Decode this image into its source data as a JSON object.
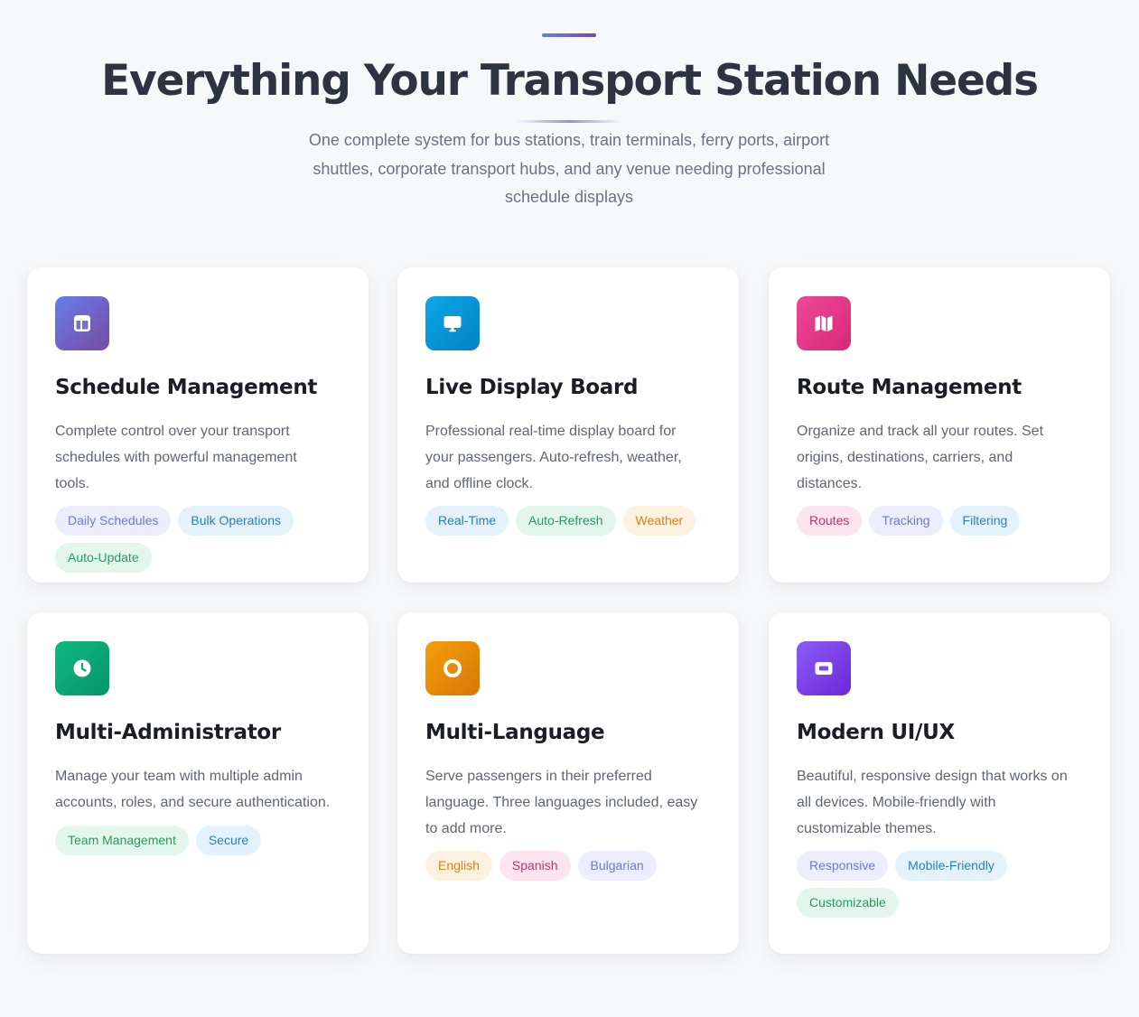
{
  "header": {
    "title": "Everything Your Transport Station Needs",
    "subtitle": "One complete system for bus stations, train terminals, ferry ports, airport shuttles, corporate transport hubs, and any venue needing professional schedule displays"
  },
  "colors": {
    "accent_start": "#667eea",
    "accent_end": "#764ba2"
  },
  "features": [
    {
      "icon": "table-icon",
      "title": "Schedule Management",
      "description": "Complete control over your transport schedules with powerful management tools.",
      "tags": [
        "Daily Schedules",
        "Bulk Operations",
        "Auto-Update"
      ]
    },
    {
      "icon": "monitor-icon",
      "title": "Live Display Board",
      "description": "Professional real-time display board for your passengers. Auto-refresh, weather, and offline clock.",
      "tags": [
        "Real-Time",
        "Auto-Refresh",
        "Weather"
      ]
    },
    {
      "icon": "map-icon",
      "title": "Route Management",
      "description": "Organize and track all your routes. Set origins, destinations, carriers, and distances.",
      "tags": [
        "Routes",
        "Tracking",
        "Filtering"
      ]
    },
    {
      "icon": "clock-icon",
      "title": "Multi-Administrator",
      "description": "Manage your team with multiple admin accounts, roles, and secure authentication.",
      "tags": [
        "Team Management",
        "Secure"
      ]
    },
    {
      "icon": "ring-icon",
      "title": "Multi-Language",
      "description": "Serve passengers in their preferred language. Three languages included, easy to add more.",
      "tags": [
        "English",
        "Spanish",
        "Bulgarian"
      ]
    },
    {
      "icon": "window-icon",
      "title": "Modern UI/UX",
      "description": "Beautiful, responsive design that works on all devices. Mobile-friendly with customizable themes.",
      "tags": [
        "Responsive",
        "Mobile-Friendly",
        "Customizable"
      ]
    }
  ]
}
